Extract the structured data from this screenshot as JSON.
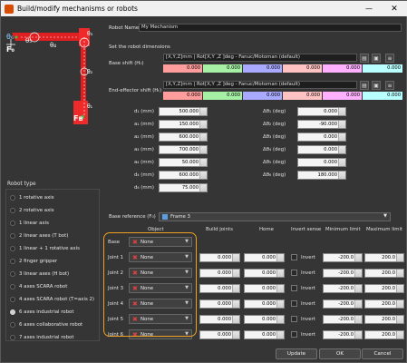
{
  "window": {
    "title": "Build/modify mechanisms or robots",
    "minimize": "—",
    "close": "✕"
  },
  "robot_name_label": "Robot Name",
  "robot_name": "My Mechanism",
  "set_dims_label": "Set the robot dimensions",
  "base_shift": {
    "label": "Base shift (H₀)",
    "format": "[X,Y,Z]mm | Rot[X,Y ,Z ]deg - Fanuc/Motoman (default)",
    "values": [
      "0.000",
      "0.000",
      "0.000",
      "0.000",
      "0.000",
      "0.000"
    ],
    "colors": [
      "#ff9c9c",
      "#a6f0a6",
      "#a9a9ff",
      "#ffc2c2",
      "#ffb0ff",
      "#b8ffff"
    ]
  },
  "ee_shift": {
    "label": "End-effector shift (Hₜ)",
    "format": "[X,Y,Z]mm | Rot[X,Y ,Z ]deg - Fanuc/Motoman (default)",
    "values": [
      "0.000",
      "0.000",
      "0.000",
      "0.000",
      "0.000",
      "0.000"
    ],
    "colors": [
      "#ff9c9c",
      "#a6f0a6",
      "#a9a9ff",
      "#ffc2c2",
      "#ffb0ff",
      "#b8ffff"
    ]
  },
  "dims": [
    {
      "label": "d₁ (mm)",
      "value": "500.000",
      "rlabel": "Δθ₁ (deg)",
      "rvalue": "0.000"
    },
    {
      "label": "a₁ (mm)",
      "value": "150.000",
      "rlabel": "Δθ₂ (deg)",
      "rvalue": "-90.000"
    },
    {
      "label": "a₂ (mm)",
      "value": "600.000",
      "rlabel": "Δθ₃ (deg)",
      "rvalue": "0.000"
    },
    {
      "label": "a₃ (mm)",
      "value": "700.000",
      "rlabel": "Δθ₄ (deg)",
      "rvalue": "0.000"
    },
    {
      "label": "a₄ (mm)",
      "value": "50.000",
      "rlabel": "Δθ₅ (deg)",
      "rvalue": "0.000"
    },
    {
      "label": "d₄ (mm)",
      "value": "600.000",
      "rlabel": "Δθ₆ (deg)",
      "rvalue": "180.000"
    },
    {
      "label": "d₆ (mm)",
      "value": "75.000",
      "rlabel": "",
      "rvalue": ""
    }
  ],
  "robot_type": {
    "label": "Robot type",
    "items": [
      "1 rotative axis",
      "2 rotative axis",
      "1 linear axis",
      "2 linear axes (T bot)",
      "1 linear + 1 rotative axis",
      "2 finger gripper",
      "3 linear axes (H bot)",
      "4 axes SCARA robot",
      "4 axes SCARA robot (T=axis 2)",
      "6 axes industrial robot",
      "6 axes collaborative robot",
      "7 axes industrial robot"
    ],
    "selected": 9
  },
  "base_ref": {
    "label": "Base reference (F₀)",
    "value": "Frame 3"
  },
  "joints_table": {
    "headers": [
      "Object",
      "Build joints",
      "Home",
      "Invert sense",
      "Minimum limit",
      "Maximum limit"
    ],
    "rows": [
      {
        "name": "Base",
        "object": "None"
      },
      {
        "name": "Joint 1",
        "object": "None",
        "build": "0.000",
        "home": "0.000",
        "invert": "Invert",
        "min": "-200.0",
        "max": "200.0"
      },
      {
        "name": "Joint 2",
        "object": "None",
        "build": "0.000",
        "home": "0.000",
        "invert": "Invert",
        "min": "-200.0",
        "max": "200.0"
      },
      {
        "name": "Joint 3",
        "object": "None",
        "build": "0.000",
        "home": "0.000",
        "invert": "Invert",
        "min": "-200.0",
        "max": "200.0"
      },
      {
        "name": "Joint 4",
        "object": "None",
        "build": "0.000",
        "home": "0.000",
        "invert": "Invert",
        "min": "-200.0",
        "max": "200.0"
      },
      {
        "name": "Joint 5",
        "object": "None",
        "build": "0.000",
        "home": "0.000",
        "invert": "Invert",
        "min": "-200.0",
        "max": "200.0"
      },
      {
        "name": "Joint 6",
        "object": "None",
        "build": "0.000",
        "home": "0.000",
        "invert": "Invert",
        "min": "-200.0",
        "max": "200.0"
      }
    ]
  },
  "diagram_labels": {
    "theta1": "θ₁",
    "theta2": "θ₂",
    "theta3": "θ₃",
    "theta4": "θ₄",
    "theta5": "θ₅",
    "theta6": "θ₆",
    "F0": "F₀",
    "FB": "Fʙ"
  },
  "buttons": {
    "update": "Update",
    "ok": "OK",
    "cancel": "Cancel"
  },
  "highlight_color": "#f0a020"
}
